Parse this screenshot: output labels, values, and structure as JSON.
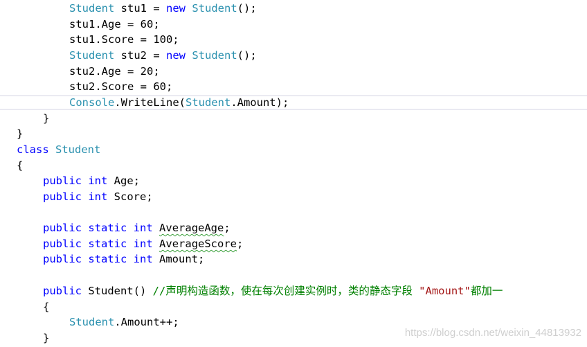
{
  "lines": [
    {
      "tokens": [
        {
          "t": "Student",
          "c": "ty"
        },
        {
          "t": " stu1 = ",
          "c": "pl"
        },
        {
          "t": "new",
          "c": "kw"
        },
        {
          "t": " ",
          "c": "pl"
        },
        {
          "t": "Student",
          "c": "ty"
        },
        {
          "t": "();",
          "c": "pl"
        }
      ]
    },
    {
      "tokens": [
        {
          "t": "stu1.Age = 60;",
          "c": "pl"
        }
      ]
    },
    {
      "tokens": [
        {
          "t": "stu1.Score = 100;",
          "c": "pl"
        }
      ]
    },
    {
      "tokens": [
        {
          "t": "Student",
          "c": "ty"
        },
        {
          "t": " stu2 = ",
          "c": "pl"
        },
        {
          "t": "new",
          "c": "kw"
        },
        {
          "t": " ",
          "c": "pl"
        },
        {
          "t": "Student",
          "c": "ty"
        },
        {
          "t": "();",
          "c": "pl"
        }
      ]
    },
    {
      "tokens": [
        {
          "t": "stu2.Age = 20;",
          "c": "pl"
        }
      ]
    },
    {
      "tokens": [
        {
          "t": "stu2.Score = 60;",
          "c": "pl"
        }
      ]
    },
    {
      "tokens": [
        {
          "t": "Console",
          "c": "ty"
        },
        {
          "t": ".WriteLine(",
          "c": "pl"
        },
        {
          "t": "Student",
          "c": "ty"
        },
        {
          "t": ".Amount);",
          "c": "pl"
        }
      ]
    },
    {
      "tokens": [
        {
          "t": "}",
          "c": "pl"
        }
      ]
    },
    {
      "tokens": [
        {
          "t": "}",
          "c": "pl"
        }
      ]
    },
    {
      "tokens": [
        {
          "t": "class",
          "c": "kw"
        },
        {
          "t": " ",
          "c": "pl"
        },
        {
          "t": "Student",
          "c": "ty"
        }
      ]
    },
    {
      "tokens": [
        {
          "t": "{",
          "c": "pl"
        }
      ]
    },
    {
      "tokens": [
        {
          "t": "public",
          "c": "kw"
        },
        {
          "t": " ",
          "c": "pl"
        },
        {
          "t": "int",
          "c": "kw"
        },
        {
          "t": " Age;",
          "c": "pl"
        }
      ]
    },
    {
      "tokens": [
        {
          "t": "public",
          "c": "kw"
        },
        {
          "t": " ",
          "c": "pl"
        },
        {
          "t": "int",
          "c": "kw"
        },
        {
          "t": " Score;",
          "c": "pl"
        }
      ]
    },
    {
      "tokens": []
    },
    {
      "tokens": [
        {
          "t": "public",
          "c": "kw"
        },
        {
          "t": " ",
          "c": "pl"
        },
        {
          "t": "static",
          "c": "kw"
        },
        {
          "t": " ",
          "c": "pl"
        },
        {
          "t": "int",
          "c": "kw"
        },
        {
          "t": " ",
          "c": "pl"
        },
        {
          "t": "AverageAge",
          "c": "pl",
          "sq": true
        },
        {
          "t": ";",
          "c": "pl"
        }
      ]
    },
    {
      "tokens": [
        {
          "t": "public",
          "c": "kw"
        },
        {
          "t": " ",
          "c": "pl"
        },
        {
          "t": "static",
          "c": "kw"
        },
        {
          "t": " ",
          "c": "pl"
        },
        {
          "t": "int",
          "c": "kw"
        },
        {
          "t": " ",
          "c": "pl"
        },
        {
          "t": "AverageScore",
          "c": "pl",
          "sq": true
        },
        {
          "t": ";",
          "c": "pl"
        }
      ]
    },
    {
      "tokens": [
        {
          "t": "public",
          "c": "kw"
        },
        {
          "t": " ",
          "c": "pl"
        },
        {
          "t": "static",
          "c": "kw"
        },
        {
          "t": " ",
          "c": "pl"
        },
        {
          "t": "int",
          "c": "kw"
        },
        {
          "t": " Amount;",
          "c": "pl"
        }
      ]
    },
    {
      "tokens": []
    },
    {
      "tokens": [
        {
          "t": "public",
          "c": "kw"
        },
        {
          "t": " ",
          "c": "pl"
        },
        {
          "t": "Student",
          "c": "pl"
        },
        {
          "t": "() ",
          "c": "pl"
        },
        {
          "t": "//声明构造函数，使在每次创建实例时，类的静态字段 ",
          "c": "cm"
        },
        {
          "t": "\"Amount\"",
          "c": "st"
        },
        {
          "t": "都加一",
          "c": "cm"
        }
      ]
    },
    {
      "tokens": [
        {
          "t": "{",
          "c": "pl"
        }
      ]
    },
    {
      "tokens": [
        {
          "t": "Student",
          "c": "ty"
        },
        {
          "t": ".Amount++;",
          "c": "pl"
        }
      ]
    },
    {
      "tokens": [
        {
          "t": "}",
          "c": "pl"
        }
      ]
    }
  ],
  "watermark": "https://blog.csdn.net/weixin_44813932",
  "colors": {
    "keyword": "#0000ff",
    "type": "#2b91af",
    "comment": "#008000",
    "string": "#a31515",
    "text": "#000000",
    "current_line_border": "#eaeaf2",
    "squiggle": "#3aa03a"
  }
}
